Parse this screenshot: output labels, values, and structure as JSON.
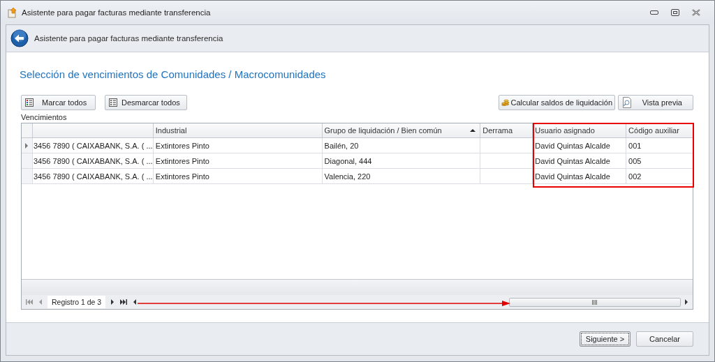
{
  "window": {
    "title": "Asistente para pagar facturas mediante transferencia"
  },
  "header": {
    "title": "Asistente para pagar facturas mediante transferencia"
  },
  "section_title": "Selección de vencimientos de Comunidades / Macrocomunidades",
  "left_buttons": [
    "Marcar todos",
    "Desmarcar todos"
  ],
  "right_buttons": [
    "Calcular saldos de liquidación",
    "Vista previa"
  ],
  "grid": {
    "label": "Vencimientos",
    "columns": [
      {
        "label": "Industrial",
        "sorted": false
      },
      {
        "label": "Grupo de liquidación / Bien común",
        "sorted": true
      },
      {
        "label": "Derrama",
        "sorted": false
      },
      {
        "label": "Usuario asignado",
        "sorted": false
      },
      {
        "label": "Código auxiliar",
        "sorted": false
      }
    ],
    "rows": [
      {
        "selected": true,
        "cuenta": "3456 7890 ( CAIXABANK, S.A. ( ...",
        "industrial": "Extintores Pinto",
        "grupo": "Bailén, 20",
        "usuario": "David Quintas Alcalde",
        "codigo": "001"
      },
      {
        "selected": false,
        "cuenta": "3456 7890 ( CAIXABANK, S.A. ( ...",
        "industrial": "Extintores Pinto",
        "grupo": "Diagonal, 444",
        "usuario": "David Quintas Alcalde",
        "codigo": "005"
      },
      {
        "selected": false,
        "cuenta": "3456 7890 ( CAIXABANK, S.A. ( ...",
        "industrial": "Extintores Pinto",
        "grupo": "Valencia, 220",
        "usuario": "David Quintas Alcalde",
        "codigo": "002"
      }
    ],
    "navigator": "Registro 1 de 3"
  },
  "footer_buttons": [
    {
      "label": "Siguiente >",
      "focused": true
    },
    {
      "label": "Cancelar",
      "focused": false
    }
  ]
}
